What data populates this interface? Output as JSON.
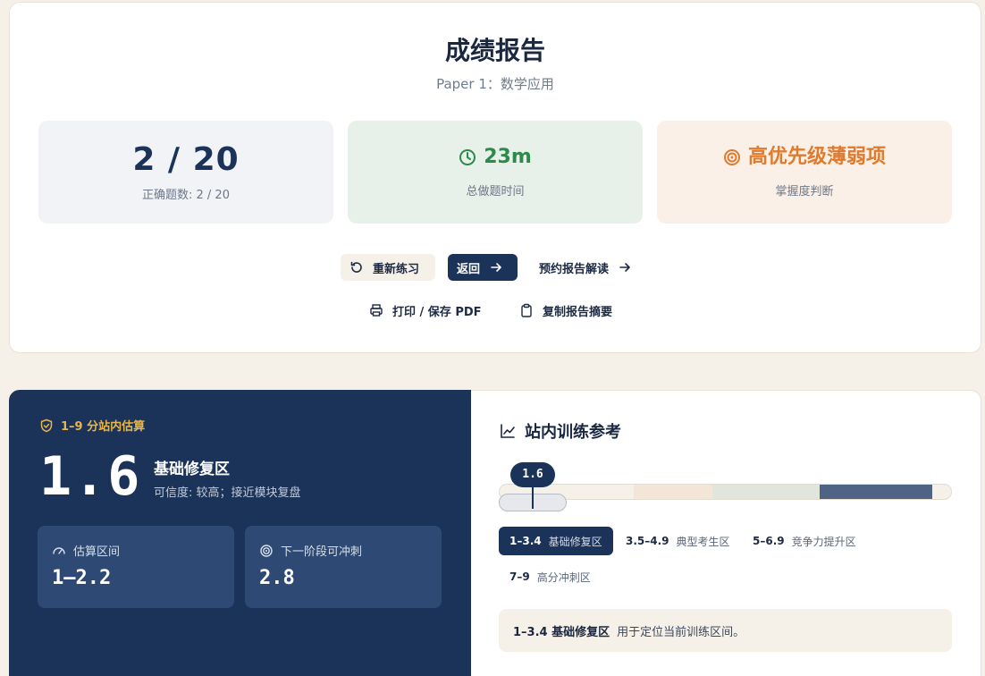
{
  "report": {
    "title": "成绩报告",
    "subtitle": "Paper 1：数学应用"
  },
  "stats": {
    "score": {
      "value": "2 / 20",
      "label": "正确题数: 2 / 20"
    },
    "time": {
      "value": "23m",
      "label": "总做题时间",
      "icon": "clock-icon",
      "color": "#2c8a4a"
    },
    "priority": {
      "value": "高优先级薄弱项",
      "label": "掌握度判断",
      "icon": "target-icon",
      "color": "#e07a2c"
    }
  },
  "actions": {
    "retry": "重新练习",
    "back": "返回",
    "book": "预约报告解读",
    "print": "打印 / 保存 PDF",
    "copy": "复制报告摘要"
  },
  "estimate": {
    "tag": "1–9 分站内估算",
    "score": "1.6",
    "zone": "基础修复区",
    "confidence": "可信度: 较高；接近模块复盘",
    "range_label": "估算区间",
    "range_value": "1–2.2",
    "next_label": "下一阶段可冲刺",
    "next_value": "2.8"
  },
  "reference": {
    "title": "站内训练参考",
    "marker": "1.6",
    "scale_min": 1,
    "scale_max": 9,
    "bands": [
      {
        "range": "1–3.4",
        "name": "基础修复区",
        "active": true
      },
      {
        "range": "3.5–4.9",
        "name": "典型考生区",
        "active": false
      },
      {
        "range": "5–6.9",
        "name": "竞争力提升区",
        "active": false
      },
      {
        "range": "7–9",
        "name": "高分冲刺区",
        "active": false
      }
    ],
    "note_zone": "1–3.4 基础修复区",
    "note_text": "用于定位当前训练区间。"
  },
  "colors": {
    "navy": "#1b3358",
    "gold": "#e8b64a",
    "band_typical": "#f3e6d8",
    "band_compete": "#e1e6dd",
    "band_high": "#4f6385"
  }
}
